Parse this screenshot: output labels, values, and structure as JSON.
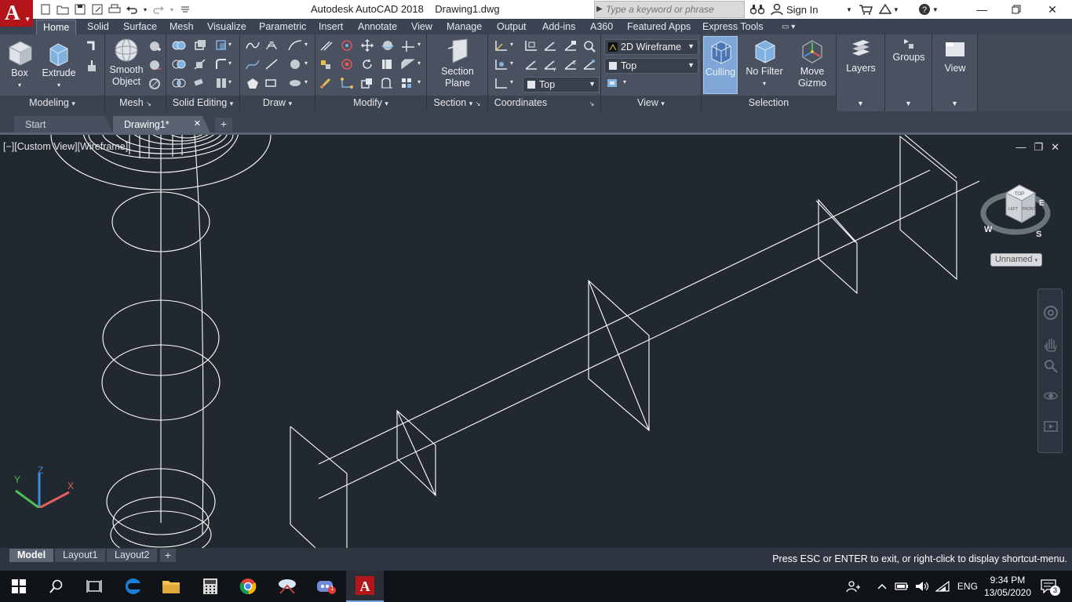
{
  "title_bar": {
    "app_name": "Autodesk AutoCAD 2018",
    "document": "Drawing1.dwg",
    "search_placeholder": "Type a keyword or phrase",
    "sign_in": "Sign In",
    "logo_letter": "A"
  },
  "ribbon_tabs": [
    "Home",
    "Solid",
    "Surface",
    "Mesh",
    "Visualize",
    "Parametric",
    "Insert",
    "Annotate",
    "View",
    "Manage",
    "Output",
    "Add-ins",
    "A360",
    "Featured Apps",
    "Express Tools"
  ],
  "ribbon": {
    "modeling": {
      "title": "Modeling",
      "box": "Box",
      "extrude": "Extrude"
    },
    "mesh": {
      "title": "Mesh",
      "smooth_object_1": "Smooth",
      "smooth_object_2": "Object"
    },
    "solid_editing": {
      "title": "Solid Editing"
    },
    "draw": {
      "title": "Draw"
    },
    "modify": {
      "title": "Modify"
    },
    "section": {
      "title": "Section",
      "section_plane_1": "Section",
      "section_plane_2": "Plane"
    },
    "coordinates": {
      "title": "Coordinates"
    },
    "view": {
      "title": "View",
      "visual_style": "2D Wireframe",
      "view_top": "Top",
      "ucs_top": "Top"
    },
    "selection": {
      "title": "Selection",
      "culling": "Culling",
      "no_filter": "No Filter",
      "move_gizmo_1": "Move",
      "move_gizmo_2": "Gizmo"
    },
    "layers": "Layers",
    "groups": "Groups",
    "view_btn": "View"
  },
  "file_tabs": {
    "start": "Start",
    "drawing": "Drawing1*"
  },
  "viewport": {
    "label": "[−][Custom View][Wireframe]",
    "viewcube_top": "TOP",
    "viewcube_left": "LEFT",
    "viewcube_front": "FRONT",
    "compass_w": "W",
    "compass_s": "S",
    "compass_e": "E",
    "ucs_name": "Unnamed",
    "axis_x": "X",
    "axis_y": "Y",
    "axis_z": "Z"
  },
  "layout_tabs": [
    "Model",
    "Layout1",
    "Layout2"
  ],
  "command_message": "Press ESC or ENTER to exit, or right-click to display shortcut-menu.",
  "taskbar": {
    "language": "ENG",
    "time": "9:34 PM",
    "date": "13/05/2020",
    "notification_count": "3",
    "discord_badge": "1"
  },
  "colors": {
    "accent_red": "#b3151b",
    "viewport_bg": "#212830",
    "ribbon_bg": "#4a5160",
    "active_highlight": "#7aa3d6"
  }
}
